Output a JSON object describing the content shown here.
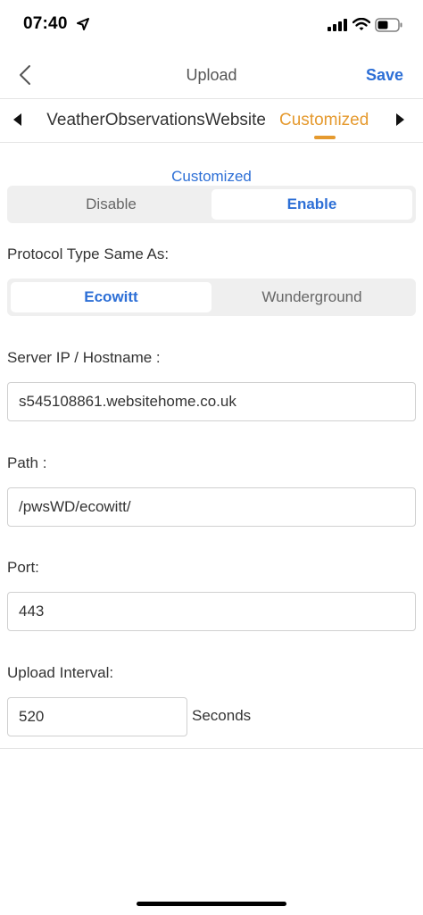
{
  "status_bar": {
    "time": "07:40"
  },
  "nav": {
    "title": "Upload",
    "save_label": "Save"
  },
  "tabs": {
    "previous_label": "VeatherObservationsWebsite",
    "active_label": "Customized"
  },
  "section": {
    "title": "Customized"
  },
  "enable_toggle": {
    "options": [
      "Disable",
      "Enable"
    ],
    "selected": "Enable"
  },
  "protocol": {
    "label": "Protocol Type Same As:",
    "options": [
      "Ecowitt",
      "Wunderground"
    ],
    "selected": "Ecowitt"
  },
  "server": {
    "label": "Server IP / Hostname :",
    "value": "s545108861.websitehome.co.uk"
  },
  "path": {
    "label": "Path :",
    "value": "/pwsWD/ecowitt/"
  },
  "port": {
    "label": "Port:",
    "value": "443"
  },
  "interval": {
    "label": "Upload Interval:",
    "value": "520",
    "unit": "Seconds"
  },
  "colors": {
    "accent_blue": "#2d6fd6",
    "accent_orange": "#e59a2f"
  },
  "icons": [
    "location-arrow-icon",
    "cellular-signal-icon",
    "wifi-icon",
    "battery-icon",
    "chevron-left-icon",
    "triangle-left-icon",
    "triangle-right-icon"
  ]
}
